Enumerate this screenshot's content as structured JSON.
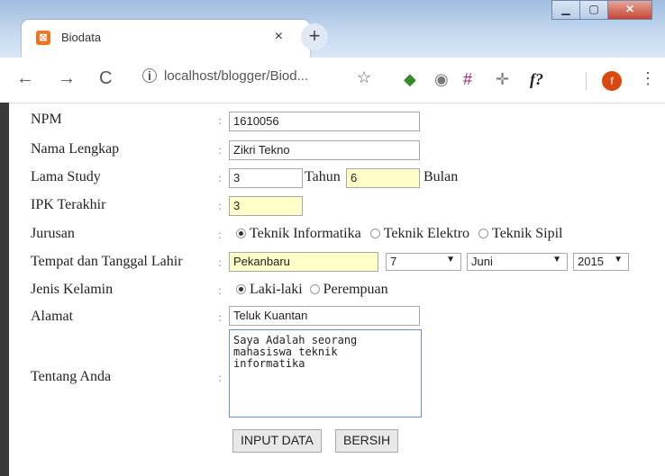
{
  "browser": {
    "tab_title": "Biodata",
    "tab_close": "×",
    "new_tab": "+",
    "url": "localhost/blogger/Biod...",
    "profile_initial": "f",
    "extensions": [
      "globe-icon",
      "shield-icon",
      "hash-icon",
      "move-icon",
      "function-icon"
    ],
    "ext_fx_label": "f?"
  },
  "form": {
    "labels": {
      "npm": "NPM",
      "nama": "Nama Lengkap",
      "lama": "Lama Study",
      "ipk": "IPK Terakhir",
      "jurusan": "Jurusan",
      "ttl": "Tempat dan Tanggal Lahir",
      "jk": "Jenis Kelamin",
      "alamat": "Alamat",
      "tentang": "Tentang Anda"
    },
    "colon": ":",
    "values": {
      "npm": "1610056",
      "nama": "Zikri Tekno",
      "tahun": "3",
      "bulan": "6",
      "ipk": "3",
      "tempat": "Pekanbaru",
      "alamat": "Teluk Kuantan",
      "tentang": "Saya Adalah seorang\nmahasiswa teknik\ninformatika"
    },
    "units": {
      "tahun": "Tahun",
      "bulan": "Bulan"
    },
    "jurusan_options": [
      "Teknik Informatika",
      "Teknik Elektro",
      "Teknik Sipil"
    ],
    "jurusan_selected": "Teknik Informatika",
    "tanggal": "7",
    "bulan_lahir": "Juni",
    "tahun_lahir": "2015",
    "jk_options": [
      "Laki-laki",
      "Perempuan"
    ],
    "jk_selected": "Laki-laki",
    "buttons": {
      "submit": "INPUT DATA",
      "reset": "BERSIH"
    }
  }
}
